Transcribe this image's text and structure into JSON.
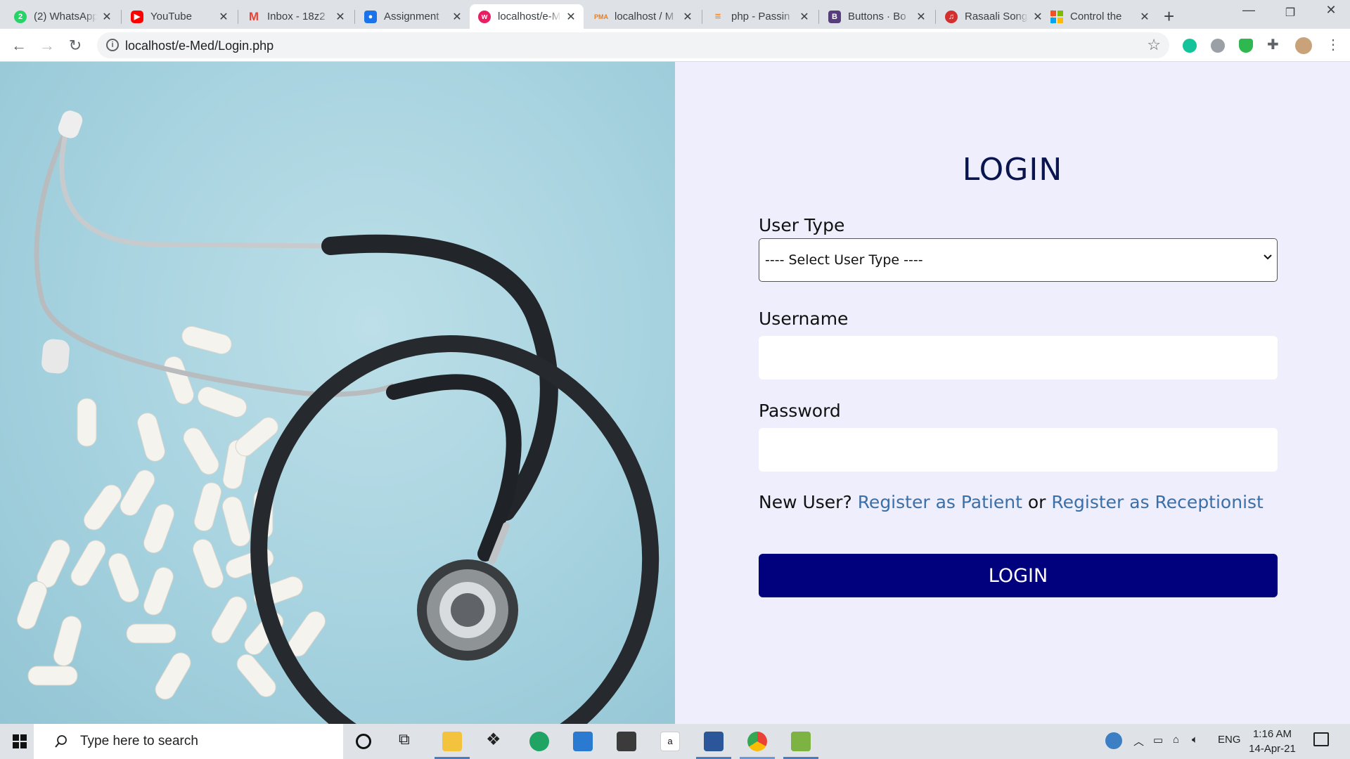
{
  "browser": {
    "tabs": [
      {
        "title": "(2) WhatsApp",
        "icon": "whatsapp-icon",
        "color": "#25d366",
        "active": false
      },
      {
        "title": "YouTube",
        "icon": "youtube-icon",
        "color": "#ff0000",
        "active": false
      },
      {
        "title": "Inbox - 18z2",
        "icon": "gmail-icon",
        "color": "#ea4335",
        "active": false
      },
      {
        "title": "Assignment",
        "icon": "classroom-icon",
        "color": "#1a73e8",
        "active": false
      },
      {
        "title": "localhost/e-Med",
        "icon": "localhost-icon",
        "color": "#e91e63",
        "active": true
      },
      {
        "title": "localhost / M",
        "icon": "phpmyadmin-icon",
        "color": "#e67e22",
        "active": false
      },
      {
        "title": "php - Passin",
        "icon": "stackoverflow-icon",
        "color": "#f48024",
        "active": false
      },
      {
        "title": "Buttons · Bo",
        "icon": "bootstrap-icon",
        "color": "#563d7c",
        "active": false
      },
      {
        "title": "Rasaali Song",
        "icon": "music-icon",
        "color": "#d32f2f",
        "active": false
      },
      {
        "title": "Control the",
        "icon": "microsoft-icon",
        "color": "#f25022",
        "active": false
      }
    ],
    "url": "localhost/e-Med/Login.php"
  },
  "form": {
    "heading": "LOGIN",
    "user_type_label": "User Type",
    "user_type_value": "---- Select User Type ----",
    "username_label": "Username",
    "password_label": "Password",
    "new_user_text": "New User?",
    "register_patient": "Register as Patient",
    "or_text": "or",
    "register_receptionist": "Register as Receptionist",
    "login_button": "LOGIN"
  },
  "colors": {
    "panel_bg": "#eeeefc",
    "heading": "#0a1550",
    "link": "#3b6fa8",
    "button": "#01017d"
  },
  "taskbar": {
    "search_placeholder": "Type here to search",
    "language": "ENG",
    "time": "1:16 AM",
    "date": "14-Apr-21"
  }
}
